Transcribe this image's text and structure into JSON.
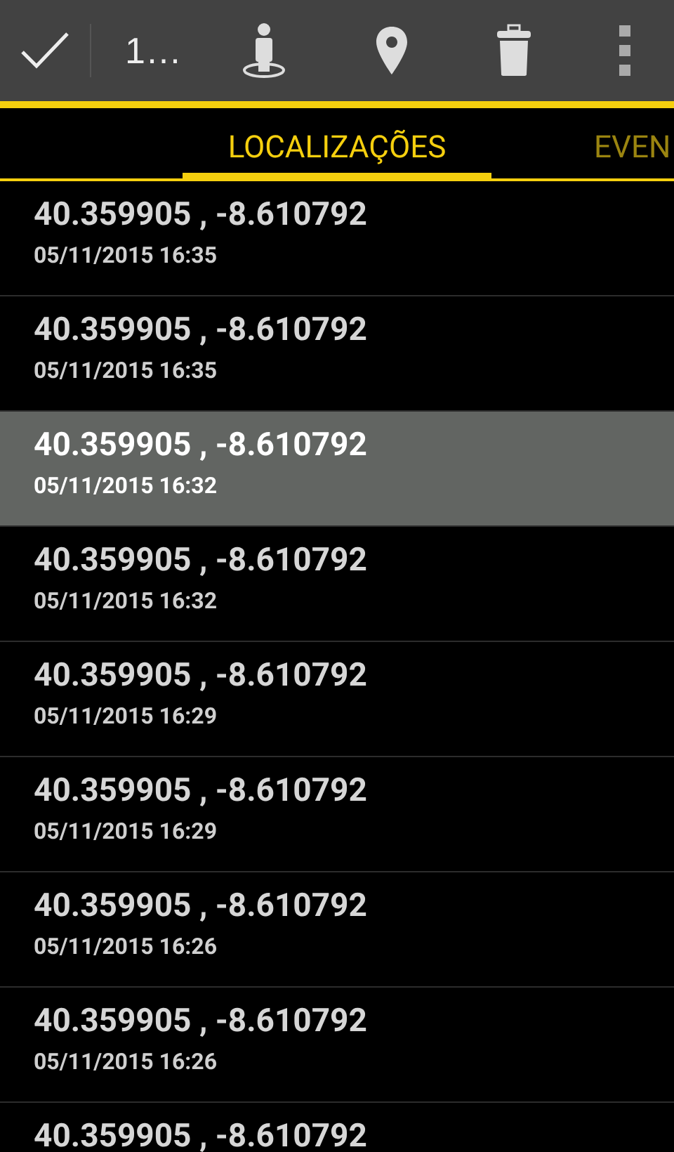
{
  "action_bar": {
    "done_label": "1…"
  },
  "tabs": [
    {
      "label": "LOCALIZAÇÕES",
      "selected": true
    },
    {
      "label": "EVEN",
      "selected": false
    }
  ],
  "locations": [
    {
      "coords": "40.359905 , -8.610792",
      "time": "05/11/2015 16:35",
      "selected": false
    },
    {
      "coords": "40.359905 , -8.610792",
      "time": "05/11/2015 16:35",
      "selected": false
    },
    {
      "coords": "40.359905 , -8.610792",
      "time": "05/11/2015 16:32",
      "selected": true
    },
    {
      "coords": "40.359905 , -8.610792",
      "time": "05/11/2015 16:32",
      "selected": false
    },
    {
      "coords": "40.359905 , -8.610792",
      "time": "05/11/2015 16:29",
      "selected": false
    },
    {
      "coords": "40.359905 , -8.610792",
      "time": "05/11/2015 16:29",
      "selected": false
    },
    {
      "coords": "40.359905 , -8.610792",
      "time": "05/11/2015 16:26",
      "selected": false
    },
    {
      "coords": "40.359905 , -8.610792",
      "time": "05/11/2015 16:26",
      "selected": false
    },
    {
      "coords": "40.359905 , -8.610792",
      "selected": false
    }
  ]
}
